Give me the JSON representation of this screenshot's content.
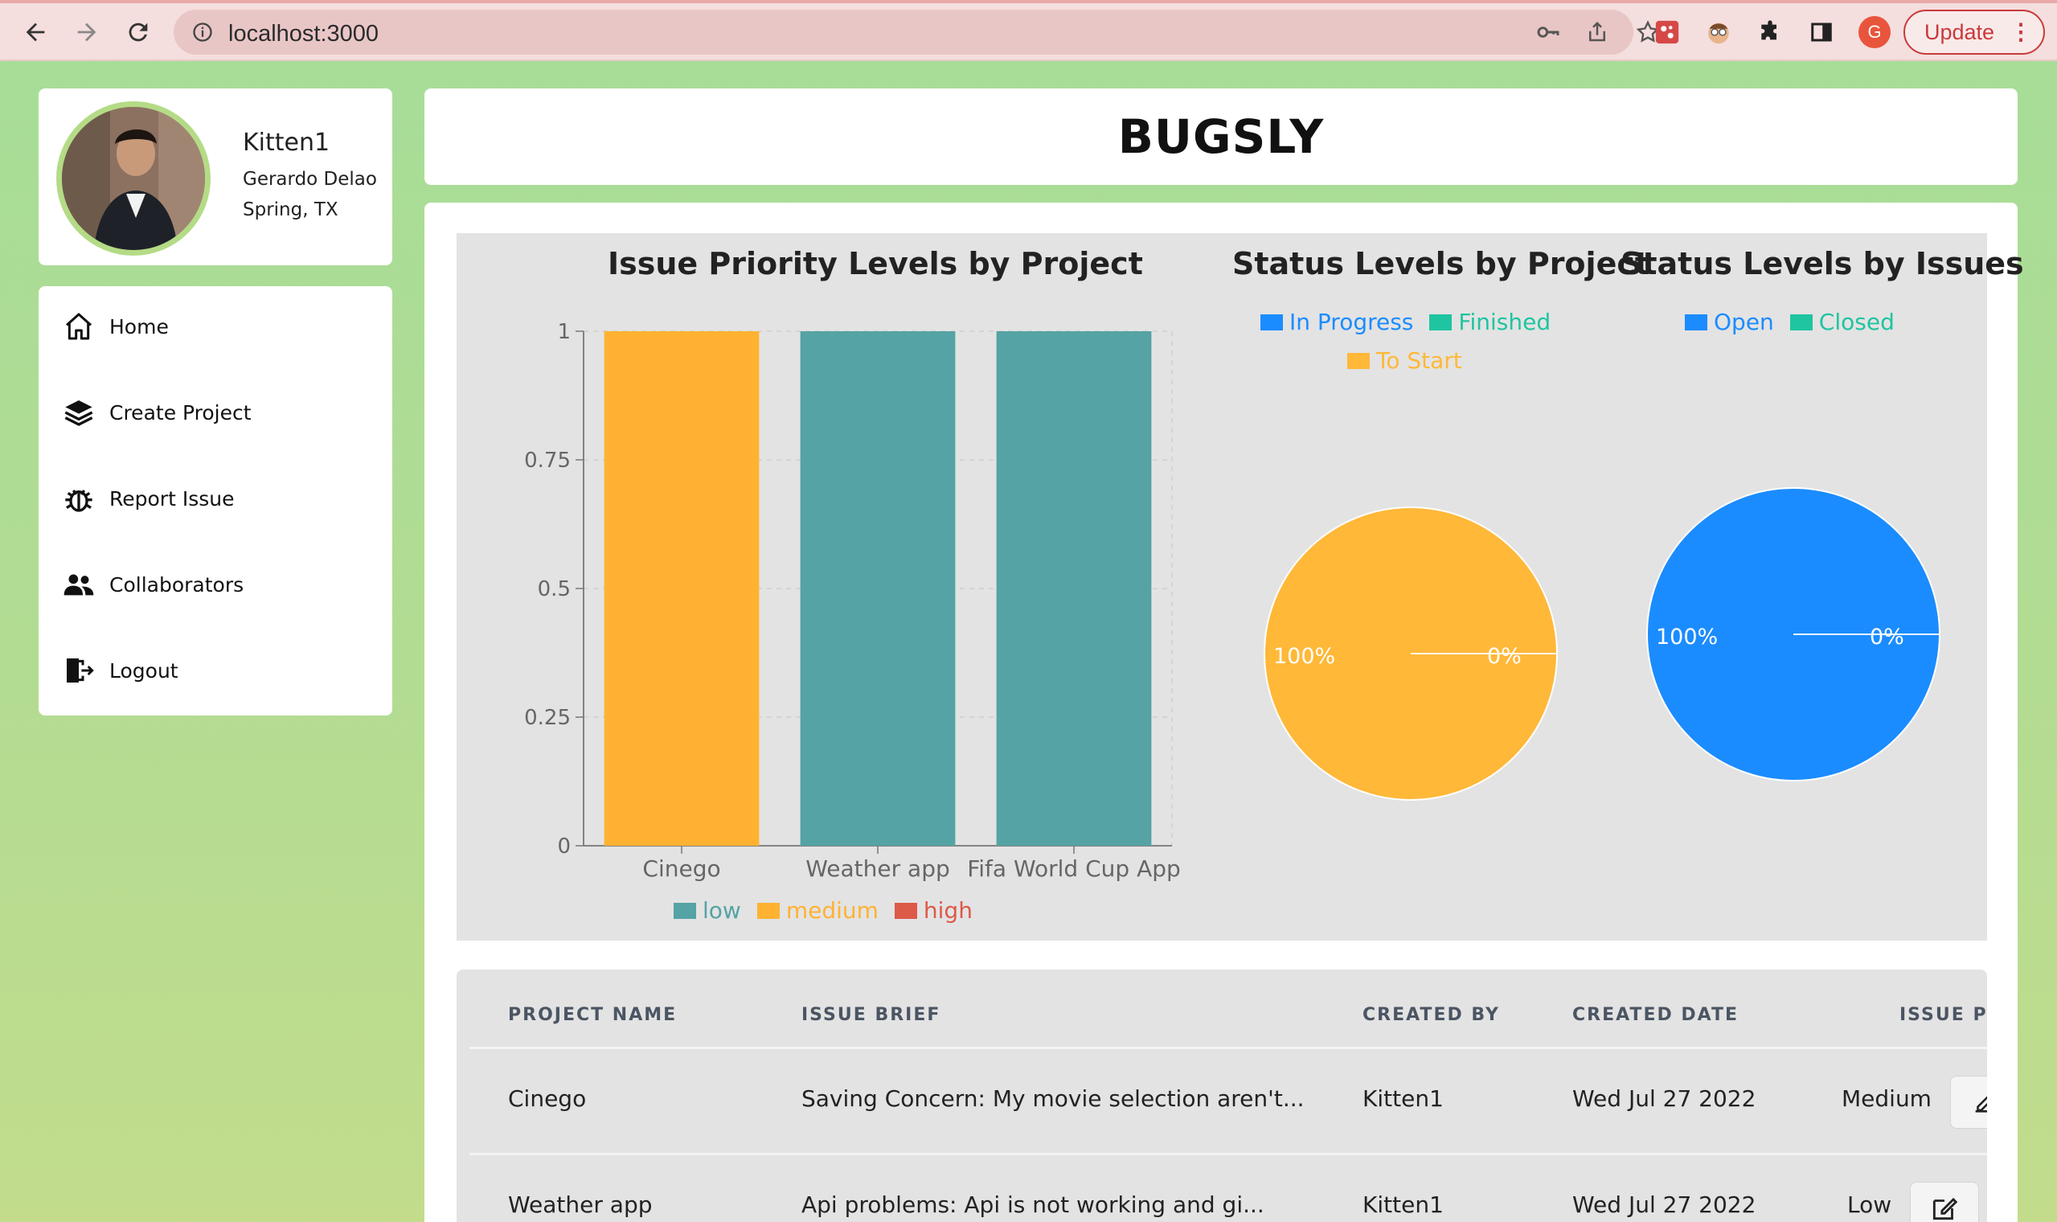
{
  "browser": {
    "url": "localhost:3000",
    "profile_initial": "G",
    "update_label": "Update",
    "menu_dots": "⋮"
  },
  "profile": {
    "username": "Kitten1",
    "full_name": "Gerardo Delao",
    "location": "Spring, TX"
  },
  "menu": {
    "items": [
      {
        "label": "Home",
        "icon": "home-icon"
      },
      {
        "label": "Create Project",
        "icon": "layers-icon"
      },
      {
        "label": "Report Issue",
        "icon": "bug-icon"
      },
      {
        "label": "Collaborators",
        "icon": "users-icon"
      },
      {
        "label": "Logout",
        "icon": "logout-icon"
      }
    ]
  },
  "header": {
    "title": "BUGSLY"
  },
  "colors": {
    "low": "#55a3a4",
    "medium": "#ffb232",
    "high": "#dd5a47",
    "open": "#1b8cff",
    "closed": "#1fc4a0",
    "in_progress": "#1b8cff",
    "finished": "#1fc4a0",
    "to_start": "#ffb838"
  },
  "chart_data": [
    {
      "type": "bar",
      "title": "Issue Priority Levels by Project",
      "categories": [
        "Cinego",
        "Weather app",
        "Fifa World Cup App"
      ],
      "series": [
        {
          "name": "low",
          "values": [
            0,
            1,
            1
          ]
        },
        {
          "name": "medium",
          "values": [
            1,
            0,
            0
          ]
        },
        {
          "name": "high",
          "values": [
            0,
            0,
            0
          ]
        }
      ],
      "yticks": [
        "0",
        "0.25",
        "0.5",
        "0.75",
        "1"
      ],
      "ylim": [
        0,
        1
      ],
      "legend": "bottom"
    },
    {
      "type": "pie",
      "title": "Status Levels by Project",
      "labels": [
        "In Progress",
        "Finished",
        "To Start"
      ],
      "values": [
        0,
        0,
        100
      ],
      "slice_labels": [
        "100%",
        "0%"
      ],
      "legend": "top"
    },
    {
      "type": "pie",
      "title": "Status Levels by Issues",
      "labels": [
        "Open",
        "Closed"
      ],
      "values": [
        100,
        0
      ],
      "slice_labels": [
        "100%",
        "0%"
      ],
      "legend": "top"
    }
  ],
  "table": {
    "headers": [
      "PROJECT NAME",
      "ISSUE BRIEF",
      "CREATED BY",
      "CREATED DATE",
      "ISSUE PI"
    ],
    "rows": [
      {
        "project": "Cinego",
        "brief": "Saving Concern: My movie selection aren't...",
        "created_by": "Kitten1",
        "date": "Wed Jul 27 2022",
        "priority": "Medium"
      },
      {
        "project": "Weather app",
        "brief": "Api problems: Api is not working and gi...",
        "created_by": "Kitten1",
        "date": "Wed Jul 27 2022",
        "priority": "Low"
      }
    ]
  }
}
